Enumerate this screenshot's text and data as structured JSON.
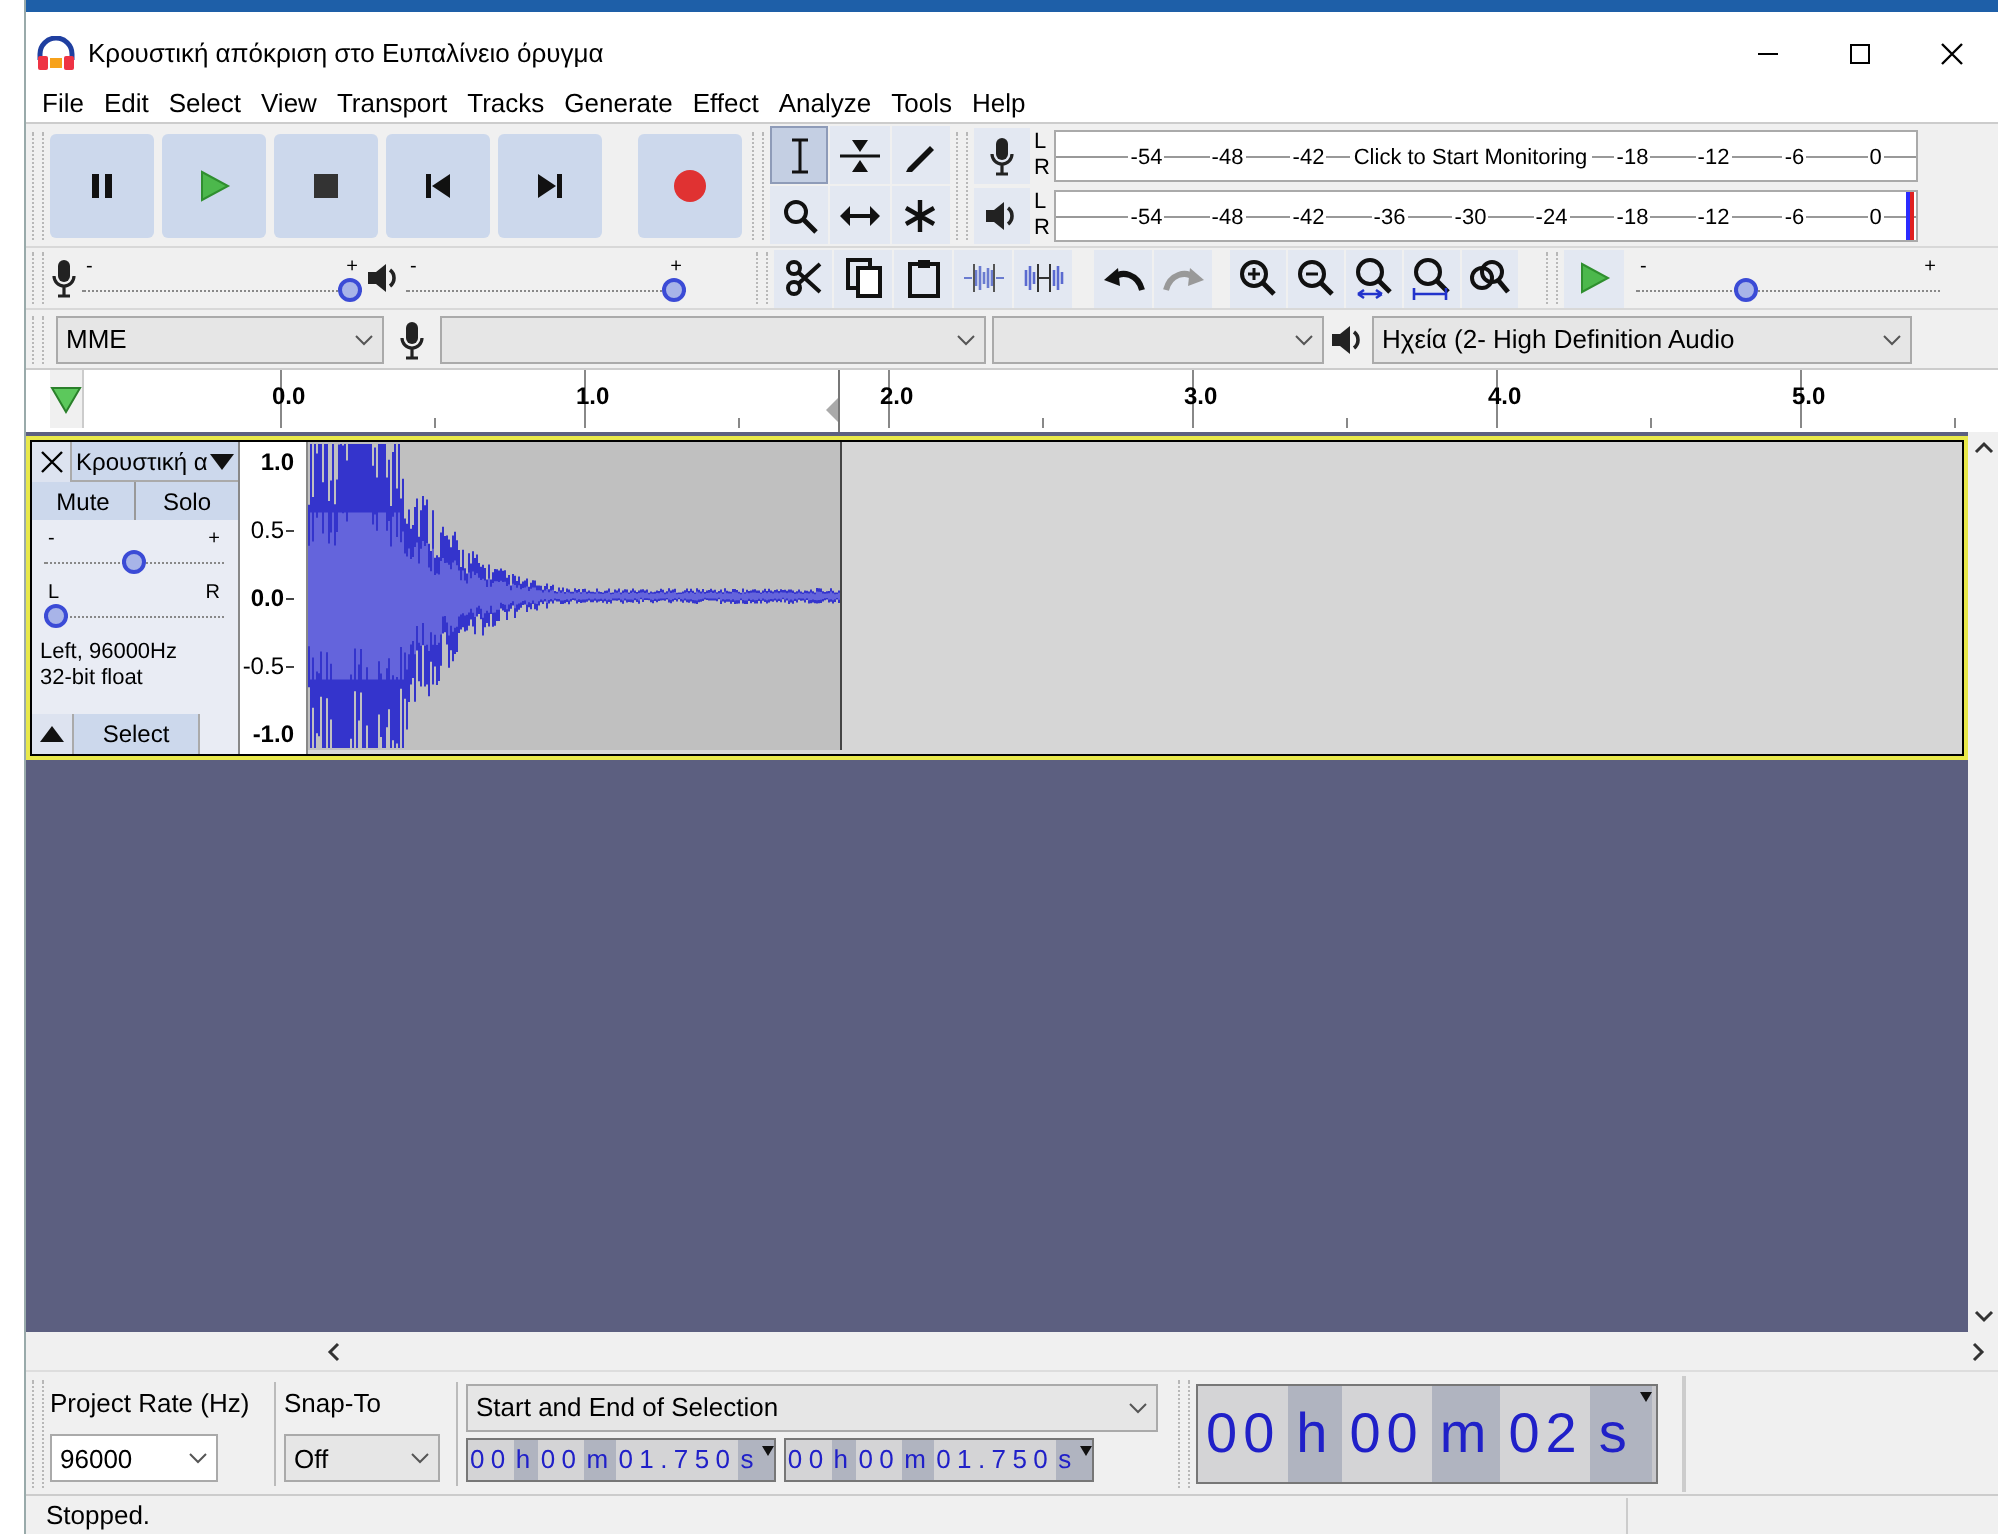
{
  "window": {
    "title": "Κρουστική απόκριση στο Ευπαλίνειο όρυγμα"
  },
  "menu": [
    "File",
    "Edit",
    "Select",
    "View",
    "Transport",
    "Tracks",
    "Generate",
    "Effect",
    "Analyze",
    "Tools",
    "Help"
  ],
  "tools": [
    {
      "kind": "select",
      "selected": true
    },
    {
      "kind": "envelope",
      "selected": false
    },
    {
      "kind": "draw",
      "selected": false
    },
    {
      "kind": "zoom",
      "selected": false
    },
    {
      "kind": "timeshift",
      "selected": false
    },
    {
      "kind": "multi",
      "selected": false
    }
  ],
  "meters": [
    {
      "kind": "recording",
      "channels": [
        "L",
        "R"
      ],
      "ticks": [
        "-54",
        "-48",
        "-42",
        "-18",
        "-12",
        "-6",
        "0"
      ],
      "prompt": "Click to Start Monitoring"
    },
    {
      "kind": "playback",
      "channels": [
        "L",
        "R"
      ],
      "ticks": [
        "-54",
        "-48",
        "-42",
        "-36",
        "-30",
        "-24",
        "-18",
        "-12",
        "-6",
        "0"
      ]
    }
  ],
  "mixer": [
    {
      "kind": "recording",
      "level": 1,
      "min_label": "-",
      "max_label": "+"
    },
    {
      "kind": "playback",
      "level": 1,
      "min_label": "-",
      "max_label": "+"
    }
  ],
  "play_at_speed": {
    "level": 0.35,
    "min_label": "-",
    "max_label": "+"
  },
  "devices": {
    "host": "MME",
    "output": "Ηχεία (2- High Definition Audio"
  },
  "ruler": {
    "ticks": [
      "0.0",
      "1.0",
      "2.0",
      "3.0",
      "4.0",
      "5.0"
    ]
  },
  "track": {
    "name": "Κρουστική α",
    "mute": "Mute",
    "solo": "Solo",
    "gain": {
      "level": 0.5,
      "min_label": "-",
      "max_label": "+"
    },
    "pan": {
      "level": 0,
      "min_label": "L",
      "max_label": "R"
    },
    "info": [
      "Left, 96000Hz",
      "32-bit float"
    ],
    "select": "Select",
    "scale": [
      "1.0",
      "0.5",
      "0.0",
      "-0.5",
      "-1.0"
    ]
  },
  "selection_toolbar": {
    "project_rate_label": "Project Rate (Hz)",
    "project_rate": "96000",
    "snap_to_label": "Snap-To",
    "snap_to": "Off",
    "selection_label": "Start and End of Selection",
    "start": [
      {
        "text": "00",
        "kind": "number"
      },
      {
        "text": "h",
        "kind": "unit"
      },
      {
        "text": "00",
        "kind": "number"
      },
      {
        "text": "m",
        "kind": "unit"
      },
      {
        "text": "01.750",
        "kind": "number"
      },
      {
        "text": "s",
        "kind": "unit"
      }
    ],
    "end": [
      {
        "text": "00",
        "kind": "number"
      },
      {
        "text": "h",
        "kind": "unit"
      },
      {
        "text": "00",
        "kind": "number"
      },
      {
        "text": "m",
        "kind": "unit"
      },
      {
        "text": "01.750",
        "kind": "number"
      },
      {
        "text": "s",
        "kind": "unit"
      }
    ]
  },
  "time": [
    {
      "text": "00",
      "kind": "number"
    },
    {
      "text": "h",
      "kind": "unit"
    },
    {
      "text": "00",
      "kind": "number"
    },
    {
      "text": "m",
      "kind": "unit"
    },
    {
      "text": "02",
      "kind": "number"
    },
    {
      "text": "s",
      "kind": "unit"
    }
  ],
  "status": "Stopped."
}
